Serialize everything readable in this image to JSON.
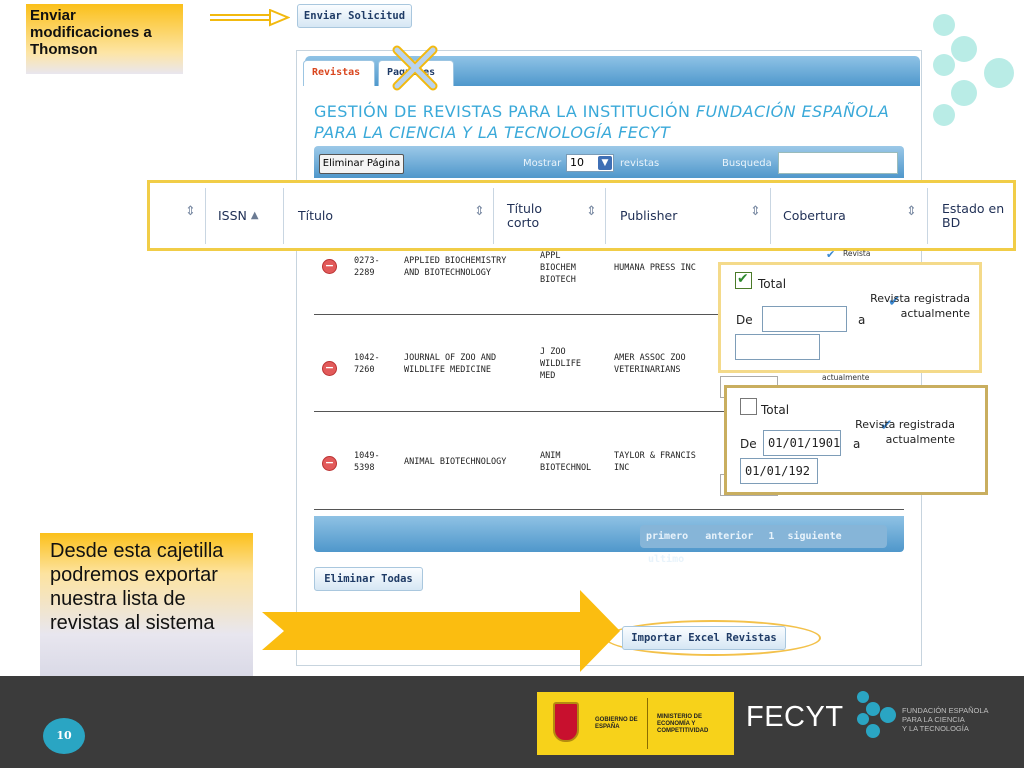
{
  "callouts": {
    "top": "Enviar modificaciones a Thomson",
    "bottom": "Desde esta cajetilla podremos exportar nuestra lista de revistas al sistema"
  },
  "buttons": {
    "send_request": "Enviar Solicitud",
    "delete_page": "Eliminar Página",
    "delete_all": "Eliminar Todas",
    "import_excel": "Importar Excel Revistas"
  },
  "tabs": [
    {
      "label": "Revistas",
      "active": true
    },
    {
      "label": "Paquetes",
      "active": false
    }
  ],
  "page_title": {
    "prefix": "GESTIÓN DE REVISTAS PARA LA INSTITUCIÓN",
    "institution": "FUNDACIÓN ESPAÑOLA PARA LA CIENCIA Y LA TECNOLOGÍA FECYT"
  },
  "toolbar": {
    "show_label": "Mostrar",
    "show_value": "10",
    "show_suffix": "revistas",
    "search_label": "Busqueda",
    "search_value": ""
  },
  "columns": [
    "ISSN",
    "Título",
    "Título corto",
    "Publisher",
    "Cobertura",
    "Estado en BD"
  ],
  "rows": [
    {
      "issn": "0273-2289",
      "title": "APPLIED BIOCHEMISTRY AND BIOTECHNOLOGY",
      "short": "APPL BIOCHEM BIOTECH",
      "publisher": "HUMANA PRESS INC",
      "status": "Revista"
    },
    {
      "issn": "1042-7260",
      "title": "JOURNAL OF ZOO AND WILDLIFE MEDICINE",
      "short": "J ZOO WILDLIFE MED",
      "publisher": "AMER ASSOC ZOO VETERINARIANS",
      "status": "actualmente"
    },
    {
      "issn": "1049-5398",
      "title": "ANIMAL BIOTECHNOLOGY",
      "short": "ANIM BIOTECHNOL",
      "publisher": "TAYLOR & FRANCIS INC",
      "status": ""
    }
  ],
  "coverage_popups": [
    {
      "total_label": "Total",
      "total_checked": true,
      "from_label": "De",
      "from_value": "",
      "to_label": "a",
      "to_value": "",
      "status": "Revista registrada actualmente"
    },
    {
      "total_label": "Total",
      "total_checked": false,
      "from_label": "De",
      "from_value": "01/01/1901",
      "to_label": "a",
      "to_value": "01/01/192",
      "status": "Revista registrada actualmente"
    }
  ],
  "pagination": {
    "first": "primero",
    "prev": "anterior",
    "page": "1",
    "next": "siguiente",
    "last": "ultimo"
  },
  "footer": {
    "page_number": "10",
    "gov1": "GOBIERNO DE ESPAÑA",
    "gov2": "MINISTERIO DE ECONOMÍA Y COMPETITIVIDAD",
    "brand": "FECYT",
    "brand_line1": "FUNDACIÓN ESPAÑOLA",
    "brand_line2": "PARA LA CIENCIA",
    "brand_line3": "Y LA TECNOLOGÍA"
  },
  "colors": {
    "accent": "#fbc01a",
    "header_blue": "#4f97cb",
    "title_blue": "#3aa9d9",
    "footer": "#3b3b3b"
  }
}
